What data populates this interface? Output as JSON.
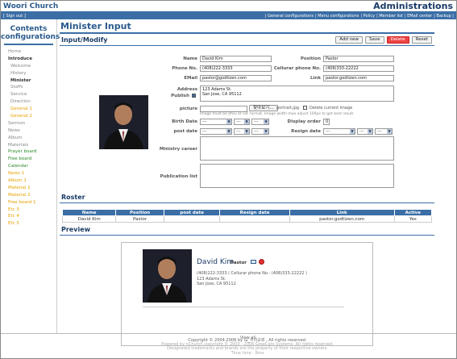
{
  "header": {
    "brand": "Woori Church",
    "admin_title": "Administrations",
    "sign_out": "[ Sign out ]",
    "links": [
      "| General configurations",
      "| Menu configurations",
      "| Policy",
      "| Member list",
      "| EMail center",
      "| Backup |"
    ]
  },
  "sidebar": {
    "title_line1": "Contents",
    "title_line2": "configurations",
    "items": [
      {
        "label": "Home",
        "style": "plain"
      },
      {
        "label": "Introduce",
        "style": "bold"
      },
      {
        "label": "Welcome",
        "style": "sub"
      },
      {
        "label": "History",
        "style": "sub"
      },
      {
        "label": "Minister",
        "style": "subbold"
      },
      {
        "label": "Staffs",
        "style": "sub"
      },
      {
        "label": "Service",
        "style": "sub"
      },
      {
        "label": "Direction",
        "style": "sub"
      },
      {
        "label": "General 1",
        "style": "suborange"
      },
      {
        "label": "General 2",
        "style": "suborange"
      },
      {
        "label": "Sermon",
        "style": "plain"
      },
      {
        "label": "News",
        "style": "plain"
      },
      {
        "label": "Album",
        "style": "plain"
      },
      {
        "label": "Materials",
        "style": "plain"
      },
      {
        "label": "Prayer board",
        "style": "green"
      },
      {
        "label": "Free board",
        "style": "green"
      },
      {
        "label": "Calendar",
        "style": "green"
      },
      {
        "label": "News 1",
        "style": "orange"
      },
      {
        "label": "Album 1",
        "style": "orange"
      },
      {
        "label": "Material 1",
        "style": "orange"
      },
      {
        "label": "Material 2",
        "style": "orange"
      },
      {
        "label": "Free board 1",
        "style": "orange"
      },
      {
        "label": "Etc 3",
        "style": "orange"
      },
      {
        "label": "Etc 4",
        "style": "orange"
      },
      {
        "label": "Etc 5",
        "style": "orange"
      }
    ]
  },
  "main": {
    "page_title": "Minister Input",
    "input_heading": "Input/Modify",
    "buttons": {
      "add_new": "Add new",
      "save": "Save",
      "delete": "Delete",
      "reset": "Reset"
    },
    "form": {
      "name_label": "Name",
      "name_value": "David Kim",
      "position_label": "Position",
      "position_value": "Pastor",
      "phone_label": "Phone No.",
      "phone_value": "(408)222-3333",
      "cell_label": "Cellurar phone No.",
      "cell_value": "(408)333-22222",
      "email_label": "EMail",
      "email_value": "pastor@godtizen.com",
      "link_label": "Link",
      "link_value": "pastor.godtizen.com",
      "address_label": "Address",
      "address_line1": "123 Adams St.",
      "address_line2": "San Jose, CA 95112",
      "publish_label": "Publish",
      "picture_label": "picture",
      "picture_browse": "찾아보기...",
      "picture_file": "portrait.jpg",
      "delete_image_label": "Delete current image",
      "picture_hint1": "Image must be JPEG or GIF format. Image width-max adjust 100px to get best result.",
      "birth_label": "Birth Date",
      "display_order_label": "Display order",
      "display_order_value": "0",
      "post_label": "post date",
      "resign_label": "Resign date",
      "select_placeholder": "---",
      "career_label": "Ministry career",
      "pub_list_label": "Publication list"
    },
    "roster_heading": "Roster",
    "roster_columns": [
      "Name",
      "Position",
      "post date",
      "Resign date",
      "Link",
      "Active"
    ],
    "roster_rows": [
      [
        "David Kim",
        "Pastor",
        "",
        "",
        "pastor.godtizen.com",
        "Yes"
      ]
    ],
    "preview_heading": "Preview",
    "preview": {
      "name": "David Kim",
      "position": "Pastor",
      "phones": "(408)222-3333 ( Cellurar phone No.: (408)333-22222 )",
      "address_line1": "123 Adams St.",
      "address_line2": "San Jose, CA 95112",
      "view_all": "View all"
    }
  },
  "footer": {
    "line1": "Copyright © 2004-2006 by 山_우리교회 ,  All rights reserved.",
    "line2": "Powered by nChurch copyright © 2003 - 2006 GreeCato Systems. All rights reserved.",
    "line3": "Designated trademarks and brands are the property of their respective owners.",
    "line4": "Time time : 8ms"
  }
}
